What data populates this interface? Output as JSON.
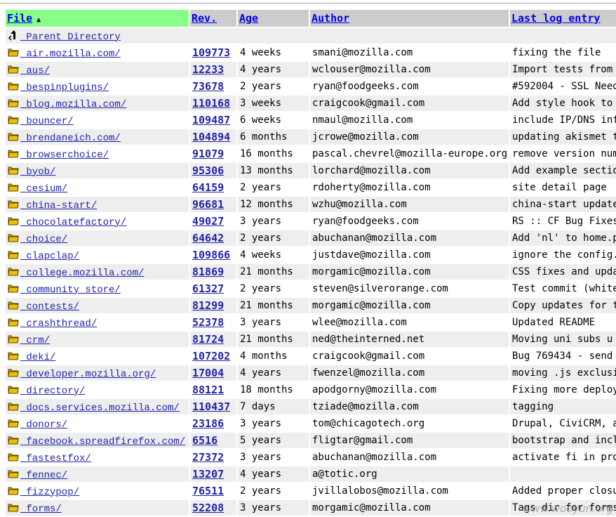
{
  "headers": {
    "file": "File",
    "rev": "Rev.",
    "age": "Age",
    "author": "Author",
    "log": "Last log entry"
  },
  "colors": {
    "active_header": "#88ff88",
    "header": "#cccccc",
    "row_alt": "#eeeeee",
    "link": "#2222aa"
  },
  "parent": {
    "label": " Parent Directory",
    "icon": "back-arrow-icon"
  },
  "rows": [
    {
      "file": " air.mozilla.com/",
      "rev": "109773",
      "age": "4 weeks",
      "author": "smani@mozilla.com",
      "log": "fixing the file"
    },
    {
      "file": " aus/",
      "rev": "12233",
      "age": "4 years",
      "author": "wclouser@mozilla.com",
      "log": "Import tests from"
    },
    {
      "file": " bespinplugins/",
      "rev": "73678",
      "age": "2 years",
      "author": "ryan@foodgeeks.com",
      "log": "#592004 - SSL Need"
    },
    {
      "file": " blog.mozilla.com/",
      "rev": "110168",
      "age": "3 weeks",
      "author": "craigcook@gmail.com",
      "log": "Add style hook to"
    },
    {
      "file": " bouncer/",
      "rev": "109487",
      "age": "6 weeks",
      "author": "nmaul@mozilla.com",
      "log": "include IP/DNS inf"
    },
    {
      "file": " brendaneich.com/",
      "rev": "104894",
      "age": "6 months",
      "author": "jcrowe@mozilla.com",
      "log": "updating akismet t"
    },
    {
      "file": " browserchoice/",
      "rev": "91079",
      "age": "16 months",
      "author": "pascal.chevrel@mozilla-europe.org",
      "log": "remove version num"
    },
    {
      "file": " byob/",
      "rev": "95306",
      "age": "13 months",
      "author": "lorchard@mozilla.com",
      "log": "Add example sectio"
    },
    {
      "file": " cesium/",
      "rev": "64159",
      "age": "2 years",
      "author": "rdoherty@mozilla.com",
      "log": "site detail page"
    },
    {
      "file": " china-start/",
      "rev": "96681",
      "age": "12 months",
      "author": "wzhu@mozilla.com",
      "log": "china-start update"
    },
    {
      "file": " chocolatefactory/",
      "rev": "49027",
      "age": "3 years",
      "author": "ryan@foodgeeks.com",
      "log": "RS :: CF Bug Fixes"
    },
    {
      "file": " choice/",
      "rev": "64642",
      "age": "2 years",
      "author": "abuchanan@mozilla.com",
      "log": "Add 'nl' to home.p"
    },
    {
      "file": " clapclap/",
      "rev": "109866",
      "age": "4 weeks",
      "author": "justdave@mozilla.com",
      "log": "ignore the config."
    },
    {
      "file": " college.mozilla.com/",
      "rev": "81869",
      "age": "21 months",
      "author": "morgamic@mozilla.com",
      "log": "CSS fixes and upda"
    },
    {
      "file": " community_store/",
      "rev": "61327",
      "age": "2 years",
      "author": "steven@silverorange.com",
      "log": "Test commit (white"
    },
    {
      "file": " contests/",
      "rev": "81299",
      "age": "21 months",
      "author": "morgamic@mozilla.com",
      "log": "Copy updates for t"
    },
    {
      "file": " crashthread/",
      "rev": "52378",
      "age": "3 years",
      "author": "wlee@mozilla.com",
      "log": "Updated README"
    },
    {
      "file": " crm/",
      "rev": "81724",
      "age": "21 months",
      "author": "ned@theinterned.net",
      "log": "Moving uni subs u"
    },
    {
      "file": " deki/",
      "rev": "107202",
      "age": "4 months",
      "author": "craigcook@gmail.com",
      "log": "Bug 769434 - send"
    },
    {
      "file": " developer.mozilla.org/",
      "rev": "17004",
      "age": "4 years",
      "author": "fwenzel@mozilla.com",
      "log": "moving .js exclusi"
    },
    {
      "file": " directory/",
      "rev": "88121",
      "age": "18 months",
      "author": "apodgorny@mozilla.com",
      "log": "Fixing more deploy"
    },
    {
      "file": " docs.services.mozilla.com/",
      "rev": "110437",
      "age": "7 days",
      "author": "tziade@mozilla.com",
      "log": "tagging"
    },
    {
      "file": " donors/",
      "rev": "23186",
      "age": "3 years",
      "author": "tom@chicagotech.org",
      "log": "Drupal, CiviCRM, a"
    },
    {
      "file": " facebook.spreadfirefox.com/",
      "rev": "6516",
      "age": "5 years",
      "author": "fligtar@gmail.com",
      "log": "bootstrap and incl"
    },
    {
      "file": " fastestfox/",
      "rev": "27372",
      "age": "3 years",
      "author": "abuchanan@mozilla.com",
      "log": "activate fi in pro"
    },
    {
      "file": " fennec/",
      "rev": "13207",
      "age": "4 years",
      "author": "a@totic.org",
      "log": ""
    },
    {
      "file": " fizzypop/",
      "rev": "76511",
      "age": "2 years",
      "author": "jvillalobos@mozilla.com",
      "log": "Added proper closu"
    },
    {
      "file": " forms/",
      "rev": "52208",
      "age": "3 years",
      "author": "morgamic@mozilla.com",
      "log": "Tags dir for forms"
    }
  ],
  "watermark": "www.wooyun.org"
}
